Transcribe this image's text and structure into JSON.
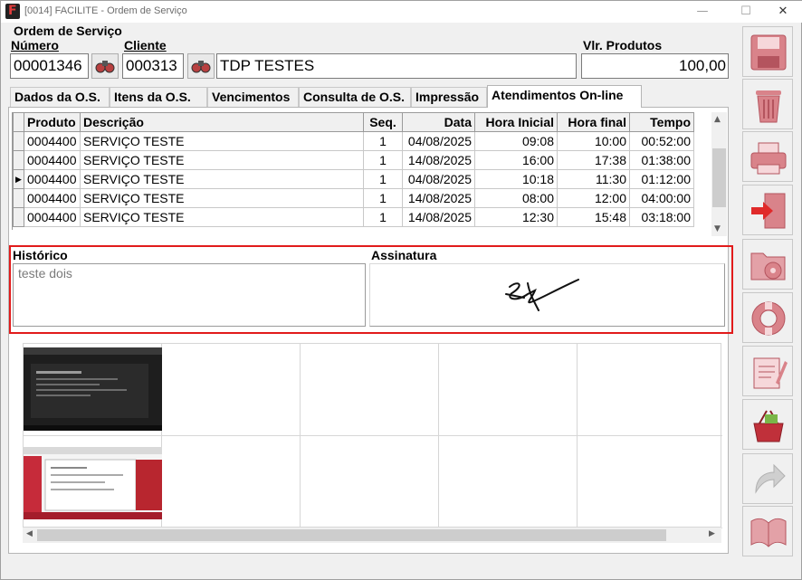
{
  "window": {
    "title": "[0014] FACILITE - Ordem de Serviço",
    "minimize": "—",
    "maximize": "☐",
    "close": "✕"
  },
  "header": {
    "section_title": "Ordem de Serviço",
    "numero_label": "Número",
    "numero_value": "00001346",
    "cliente_label": "Cliente",
    "cliente_code": "000313",
    "cliente_name": "TDP TESTES",
    "vlr_label": "Vlr. Produtos",
    "vlr_value": "100,00"
  },
  "tabs": [
    {
      "label": "Dados da O.S."
    },
    {
      "label": "Itens da O.S."
    },
    {
      "label": "Vencimentos"
    },
    {
      "label": "Consulta de O.S."
    },
    {
      "label": "Impressão"
    },
    {
      "label": "Atendimentos On-line"
    }
  ],
  "grid": {
    "columns": [
      "Produto",
      "Descrição",
      "Seq.",
      "Data",
      "Hora Inicial",
      "Hora final",
      "Tempo"
    ],
    "rows": [
      [
        "0004400",
        "SERVIÇO TESTE",
        "1",
        "04/08/2025",
        "09:08",
        "10:00",
        "00:52:00"
      ],
      [
        "0004400",
        "SERVIÇO TESTE",
        "1",
        "14/08/2025",
        "16:00",
        "17:38",
        "01:38:00"
      ],
      [
        "0004400",
        "SERVIÇO TESTE",
        "1",
        "04/08/2025",
        "10:18",
        "11:30",
        "01:12:00"
      ],
      [
        "0004400",
        "SERVIÇO TESTE",
        "1",
        "14/08/2025",
        "08:00",
        "12:00",
        "04:00:00"
      ],
      [
        "0004400",
        "SERVIÇO TESTE",
        "1",
        "14/08/2025",
        "12:30",
        "15:48",
        "03:18:00"
      ]
    ],
    "current_row_marker": "▶"
  },
  "historico": {
    "label": "Histórico",
    "value": "teste dois"
  },
  "assinatura": {
    "label": "Assinatura"
  },
  "toolbar": [
    {
      "icon": "save-icon"
    },
    {
      "icon": "trash-icon"
    },
    {
      "icon": "printer-icon"
    },
    {
      "icon": "exit-icon"
    },
    {
      "icon": "folder-settings-icon"
    },
    {
      "icon": "lifebuoy-icon"
    },
    {
      "icon": "notepad-icon"
    },
    {
      "icon": "basket-icon"
    },
    {
      "icon": "return-arrow-icon"
    },
    {
      "icon": "book-icon"
    }
  ],
  "colors": {
    "highlight_border": "#e11b1b",
    "toolbar_icon": "#d9838a"
  }
}
